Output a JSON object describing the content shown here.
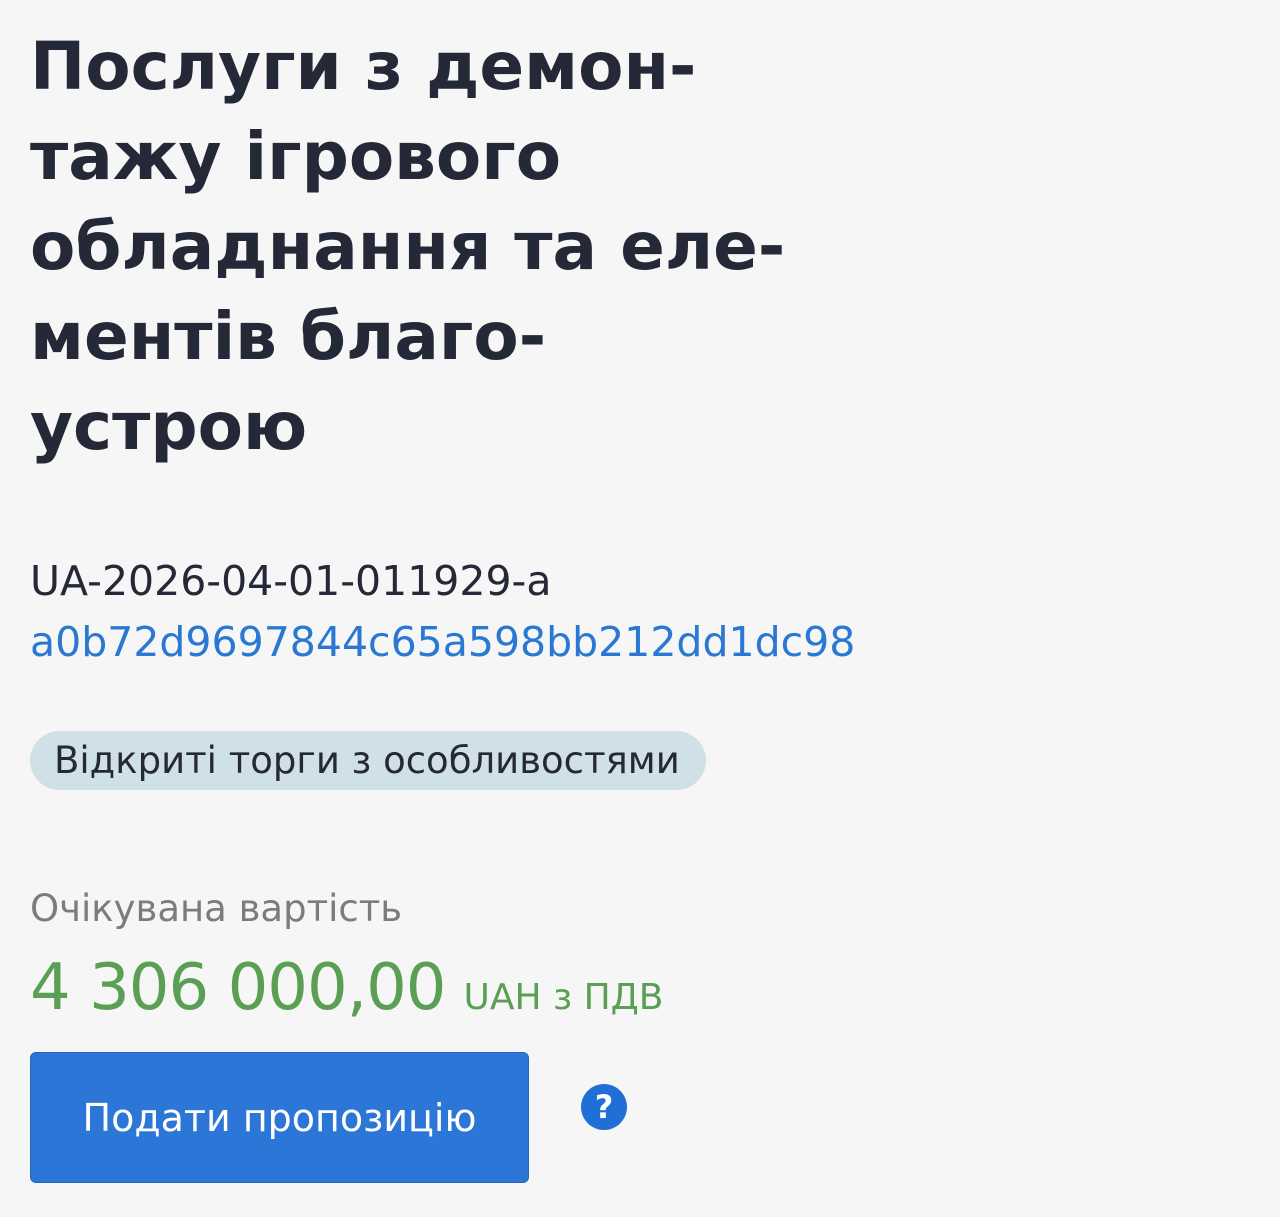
{
  "tender": {
    "title_lines": [
      "Послуги з демон-",
      "тажу ігрового",
      "обладнання та еле-",
      "ментів благо-",
      "устрою"
    ],
    "id": "UA-2026-04-01-011929-a",
    "hash": "a0b72d9697844c65a598bb212dd1dc98",
    "procedure_badge": "Відкриті торги з особливостями"
  },
  "budget": {
    "label": "Очікувана вартість",
    "amount": "4 306 000,00",
    "currency_note": "UAH з ПДВ"
  },
  "actions": {
    "submit_label": "Подати пропозицію",
    "help_symbol": "?"
  },
  "colors": {
    "background": "#f6f6f6",
    "title_text": "#252836",
    "link_blue": "#2a78d2",
    "badge_bg": "#cfe0e7",
    "amount_green": "#5a9f54",
    "button_blue": "#2b76d6"
  }
}
